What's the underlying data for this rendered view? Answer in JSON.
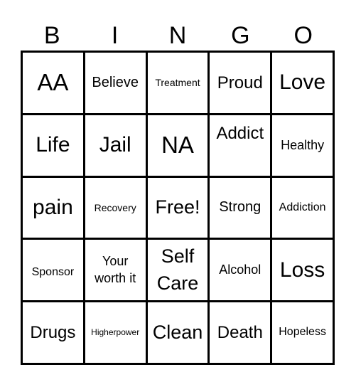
{
  "header": {
    "letters": [
      "B",
      "I",
      "N",
      "G",
      "O"
    ]
  },
  "board": {
    "rows": [
      [
        "AA",
        "Believe",
        "Treatment",
        "Proud",
        "Love"
      ],
      [
        "Life",
        "Jail",
        "NA",
        "Addict",
        "Healthy"
      ],
      [
        "pain",
        "Recovery",
        "Free!",
        "Strong",
        "Addiction"
      ],
      [
        "Sponsor",
        "Your worth it",
        "Self Care",
        "Alcohol",
        "Loss"
      ],
      [
        "Drugs",
        "Higherpower",
        "Clean",
        "Death",
        "Hopeless"
      ]
    ]
  }
}
